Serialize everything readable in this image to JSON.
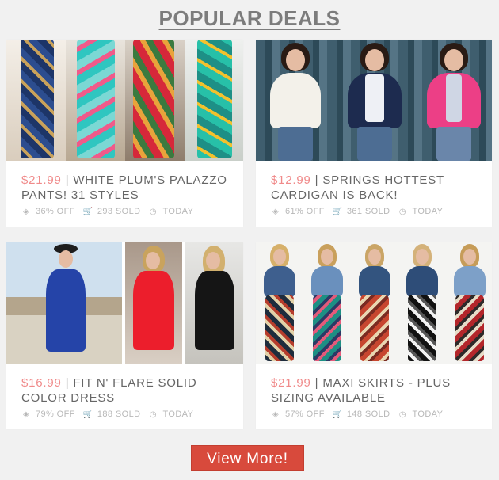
{
  "header": {
    "title": "POPULAR DEALS"
  },
  "deals": [
    {
      "price": "$21.99",
      "title": "| WHITE PLUM'S PALAZZO PANTS! 31 STYLES",
      "off": "36% OFF",
      "sold": "293 SOLD",
      "time": "TODAY"
    },
    {
      "price": "$12.99",
      "title": "| SPRINGS HOTTEST CARDIGAN IS BACK!",
      "off": "61% OFF",
      "sold": "361 SOLD",
      "time": "TODAY"
    },
    {
      "price": "$16.99",
      "title": "| FIT N' FLARE SOLID COLOR DRESS",
      "off": "79% OFF",
      "sold": "188 SOLD",
      "time": "TODAY"
    },
    {
      "price": "$21.99",
      "title": "| MAXI SKIRTS - PLUS SIZING AVAILABLE",
      "off": "57% OFF",
      "sold": "148 SOLD",
      "time": "TODAY"
    }
  ],
  "cta": {
    "label": "View More!"
  },
  "icons": {
    "tag": "tag-icon",
    "cart": "cart-icon",
    "clock": "clock-icon"
  },
  "colors": {
    "price": "#f08a8a",
    "button": "#d84a3c",
    "title": "#7c7c7c"
  }
}
